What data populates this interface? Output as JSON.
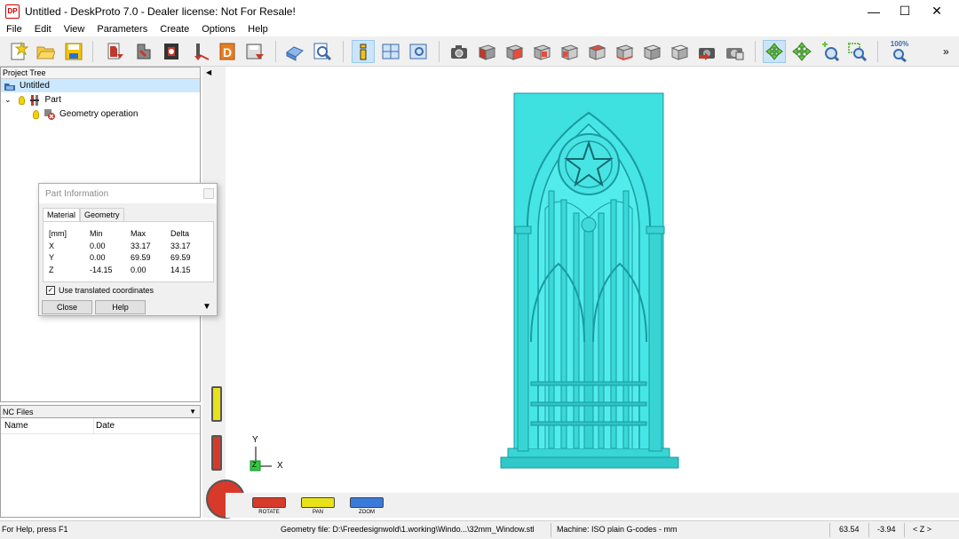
{
  "app": {
    "title": "Untitled - DeskProto 7.0 - Dealer license: Not For Resale!",
    "icon_text": "DP",
    "window_controls": [
      "minimize-icon",
      "maximize-icon",
      "close-icon"
    ]
  },
  "menu": [
    "File",
    "Edit",
    "View",
    "Parameters",
    "Create",
    "Options",
    "Help"
  ],
  "toolbar": {
    "icons": [
      "new-project-icon",
      "open-project-icon",
      "save-project-icon",
      "import-geometry-icon",
      "part-parameters-icon",
      "create-operation-icon",
      "tool-icon",
      "drawing-icon",
      "save-nc-icon",
      "machine-icon",
      "preview-icon",
      "part-information-icon",
      "window-layout-icon",
      "screen-view-icon",
      "camera-icon",
      "view-front-icon",
      "view-back-icon",
      "view-left-icon",
      "view-right-icon",
      "view-top-icon",
      "view-bottom-icon",
      "view-iso-icon",
      "view-solid-icon",
      "camera-export-icon",
      "camera-save-icon",
      "rotate-tool-icon",
      "pan-tool-icon",
      "zoom-tool-icon",
      "zoom-window-icon",
      "zoom-100-icon"
    ],
    "zoom_label": "100%",
    "overflow": "»"
  },
  "project_tree": {
    "header": "Project Tree",
    "items": [
      {
        "label": "Untitled"
      },
      {
        "label": "Part"
      },
      {
        "label": "Geometry operation"
      }
    ]
  },
  "nc_files": {
    "header": "NC Files",
    "columns": [
      "Name",
      "Date"
    ]
  },
  "part_info_dialog": {
    "title": "Part Information",
    "tabs": [
      "Material",
      "Geometry"
    ],
    "headers": [
      "[mm]",
      "Min",
      "Max",
      "Delta"
    ],
    "rows": [
      {
        "axis": "X",
        "min": "0.00",
        "max": "33.17",
        "delta": "33.17"
      },
      {
        "axis": "Y",
        "min": "0.00",
        "max": "69.59",
        "delta": "69.59"
      },
      {
        "axis": "Z",
        "min": "-14.15",
        "max": "0.00",
        "delta": "14.15"
      }
    ],
    "checkbox_label": "Use translated coordinates",
    "checkbox_checked": true,
    "buttons": [
      "Close",
      "Help"
    ]
  },
  "viewport": {
    "model_color": "#3ee0e0",
    "axes": {
      "y": "Y",
      "z": "Z",
      "x": "X"
    },
    "nav_buttons": [
      {
        "label": "ROTATE",
        "color": "#d83a2a"
      },
      {
        "label": "PAN",
        "color": "#e8e21a"
      },
      {
        "label": "ZOOM",
        "color": "#3a7ad8"
      }
    ]
  },
  "statusbar": {
    "help": "For Help, press F1",
    "geometry_file": "Geometry file: D:\\Freedesignwold\\1.working\\Windo...\\32mm_Window.stl",
    "machine": "Machine: ISO plain G-codes - mm",
    "x": "63.54",
    "y": "-3.94",
    "view": "< Z >"
  }
}
